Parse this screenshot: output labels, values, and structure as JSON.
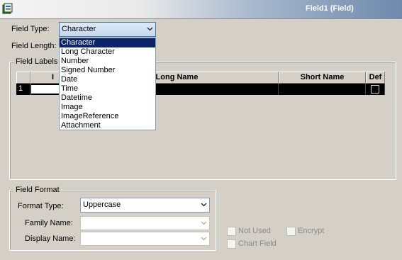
{
  "window": {
    "title": "Field1 (Field)"
  },
  "field_type": {
    "label": "Field Type:",
    "value": "Character"
  },
  "field_length": {
    "label": "Field Length:"
  },
  "dropdown": {
    "options": [
      "Character",
      "Long Character",
      "Number",
      "Signed Number",
      "Date",
      "Time",
      "Datetime",
      "Image",
      "ImageReference",
      "Attachment"
    ],
    "selected_index": 0
  },
  "field_labels": {
    "caption": "Field Labels",
    "columns": [
      "I",
      "Long Name",
      "Short Name",
      "Def"
    ],
    "rows": [
      {
        "number": "1",
        "long_name": "",
        "short_name": "",
        "default": false
      }
    ]
  },
  "field_format": {
    "caption": "Field Format",
    "format_type_label": "Format Type:",
    "format_type_value": "Uppercase",
    "family_name_label": "Family Name:",
    "display_name_label": "Display Name:"
  },
  "options": {
    "not_used": "Not Used",
    "encrypt": "Encrypt",
    "chart_field": "Chart Field"
  },
  "colors": {
    "selection": "#0a246a",
    "window_bg": "#d4d0c8",
    "title_gradient_end": "#6f8aad"
  }
}
